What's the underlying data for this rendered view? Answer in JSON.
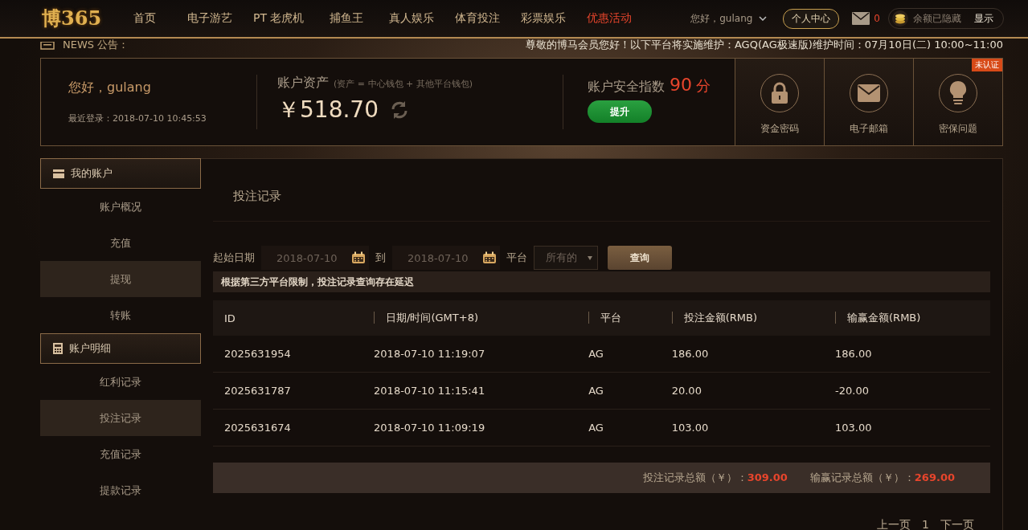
{
  "header": {
    "logo": "博365",
    "nav": [
      {
        "label": "首页",
        "highlighted": false
      },
      {
        "label": "电子游艺",
        "highlighted": false
      },
      {
        "label": "PT 老虎机",
        "highlighted": false
      },
      {
        "label": "捕鱼王",
        "highlighted": false
      },
      {
        "label": "真人娱乐",
        "highlighted": false
      },
      {
        "label": "体育投注",
        "highlighted": false
      },
      {
        "label": "彩票娱乐",
        "highlighted": false
      },
      {
        "label": "优惠活动",
        "highlighted": true
      }
    ],
    "greeting": "您好，gulang",
    "center_button": "个人中心",
    "message_count": "0",
    "balance_text": "余额已隐藏",
    "balance_toggle": "显示"
  },
  "news": {
    "label": "NEWS 公告：",
    "text": "尊敬的博马会员您好！以下平台将实施维护：AGQ(AG极速版)维护时间：07月10日(二) 10:00~11:00"
  },
  "account": {
    "greeting": "您好，gulang",
    "last_login": "最近登录：2018-07-10 10:45:53",
    "assets_label": "账户资产",
    "assets_note": "(资产 = 中心钱包 + 其他平台钱包)",
    "amount": "￥518.70",
    "security_label": "账户安全指数",
    "score": "90",
    "score_unit": "分",
    "upgrade": "提升",
    "shortcuts": [
      {
        "label": "资金密码",
        "kind": "lock"
      },
      {
        "label": "电子邮箱",
        "kind": "mail"
      },
      {
        "label": "密保问题",
        "kind": "bulb",
        "badge": "未认证"
      }
    ]
  },
  "sidebar": [
    {
      "title": "我的账户",
      "kind": "wallet",
      "items": [
        {
          "label": "账户概况",
          "selected": false
        },
        {
          "label": "充值",
          "selected": false
        },
        {
          "label": "提现",
          "selected": true
        },
        {
          "label": "转账",
          "selected": false
        }
      ]
    },
    {
      "title": "账户明细",
      "kind": "calculator",
      "items": [
        {
          "label": "红利记录",
          "selected": false
        },
        {
          "label": "投注记录",
          "selected": true
        },
        {
          "label": "充值记录",
          "selected": false
        },
        {
          "label": "提款记录",
          "selected": false
        }
      ]
    }
  ],
  "main": {
    "title": "投注记录",
    "start_label": "起始日期",
    "start_date": "2018-07-10",
    "to_label": "到",
    "end_date": "2018-07-10",
    "platform_label": "平台",
    "platform": "所有的",
    "query": "查询",
    "notice": "根据第三方平台限制，投注记录查询存在延迟",
    "table": {
      "columns": [
        "ID",
        "日期/时间(GMT+8)",
        "平台",
        "投注金额(RMB)",
        "输赢金额(RMB)"
      ],
      "rows": [
        [
          "2025631954",
          "2018-07-10 11:19:07",
          "AG",
          "186.00",
          "186.00"
        ],
        [
          "2025631787",
          "2018-07-10 11:15:41",
          "AG",
          "20.00",
          "-20.00"
        ],
        [
          "2025631674",
          "2018-07-10 11:09:19",
          "AG",
          "103.00",
          "103.00"
        ]
      ]
    },
    "bet_total_label": "投注记录总额（￥）：",
    "bet_total": "309.00",
    "win_total_label": "输赢记录总额（￥）：",
    "win_total": "269.00",
    "pagination": {
      "prev": "上一页",
      "page": "1",
      "next": "下一页"
    }
  }
}
